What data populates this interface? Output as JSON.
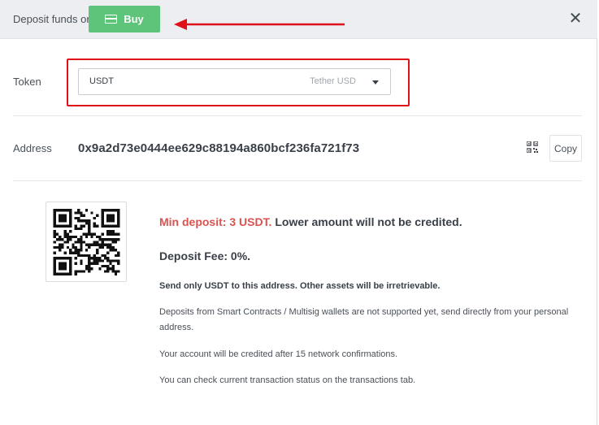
{
  "header": {
    "title": "Deposit funds or",
    "buy_label": "Buy"
  },
  "token": {
    "label": "Token",
    "selected_symbol": "USDT",
    "selected_name": "Tether USD"
  },
  "address": {
    "label": "Address",
    "value": "0x9a2d73e0444ee629c88194a860bcf236fa721f73",
    "copy_label": "Copy"
  },
  "info": {
    "min_deposit_highlight": "Min deposit: 3 USDT.",
    "min_deposit_rest": "Lower amount will not be credited.",
    "fee": "Deposit Fee: 0%.",
    "warning": "Send only USDT to this address. Other assets will be irretrievable.",
    "note_contracts": "Deposits from Smart Contracts / Multisig wallets are not supported yet, send directly from your personal address.",
    "note_confirmations": "Your account will be credited after 15 network confirmations.",
    "note_status": "You can check current transaction status on the transactions tab."
  },
  "colors": {
    "buy_green": "#5dc47a",
    "annotation_red": "#e0101b",
    "min_deposit_red": "#d9534f",
    "header_bg": "#eceef1"
  },
  "icons": [
    "card-icon",
    "close-icon",
    "chevron-down-icon",
    "qr-code-icon",
    "qr-code-image"
  ]
}
